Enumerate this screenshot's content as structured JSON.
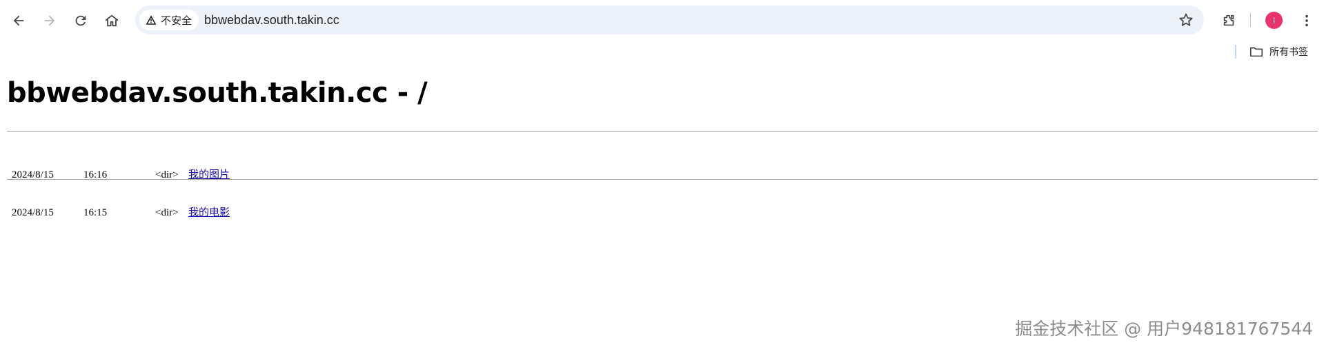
{
  "browser": {
    "url": "bbwebdav.south.takin.cc",
    "security_label": "不安全",
    "profile_initial": "I",
    "bookmarks_all_label": "所有书签"
  },
  "page": {
    "title": "bbwebdav.south.takin.cc - /",
    "entries": [
      {
        "date": "2024/8/15",
        "time": "16:16",
        "type": "<dir>",
        "name": "我的图片"
      },
      {
        "date": "2024/8/15",
        "time": "16:15",
        "type": "<dir>",
        "name": "我的电影"
      }
    ]
  },
  "watermark": "掘金技术社区 @ 用户948181767544",
  "icons": [
    "back-arrow-icon",
    "forward-arrow-icon",
    "reload-icon",
    "home-icon",
    "warning-icon",
    "star-icon",
    "extensions-icon",
    "kebab-menu-icon",
    "folder-icon"
  ],
  "colors": {
    "accent_avatar": "#e8336c",
    "link": "#1a0dab",
    "omnibox": "#edf1f9"
  }
}
